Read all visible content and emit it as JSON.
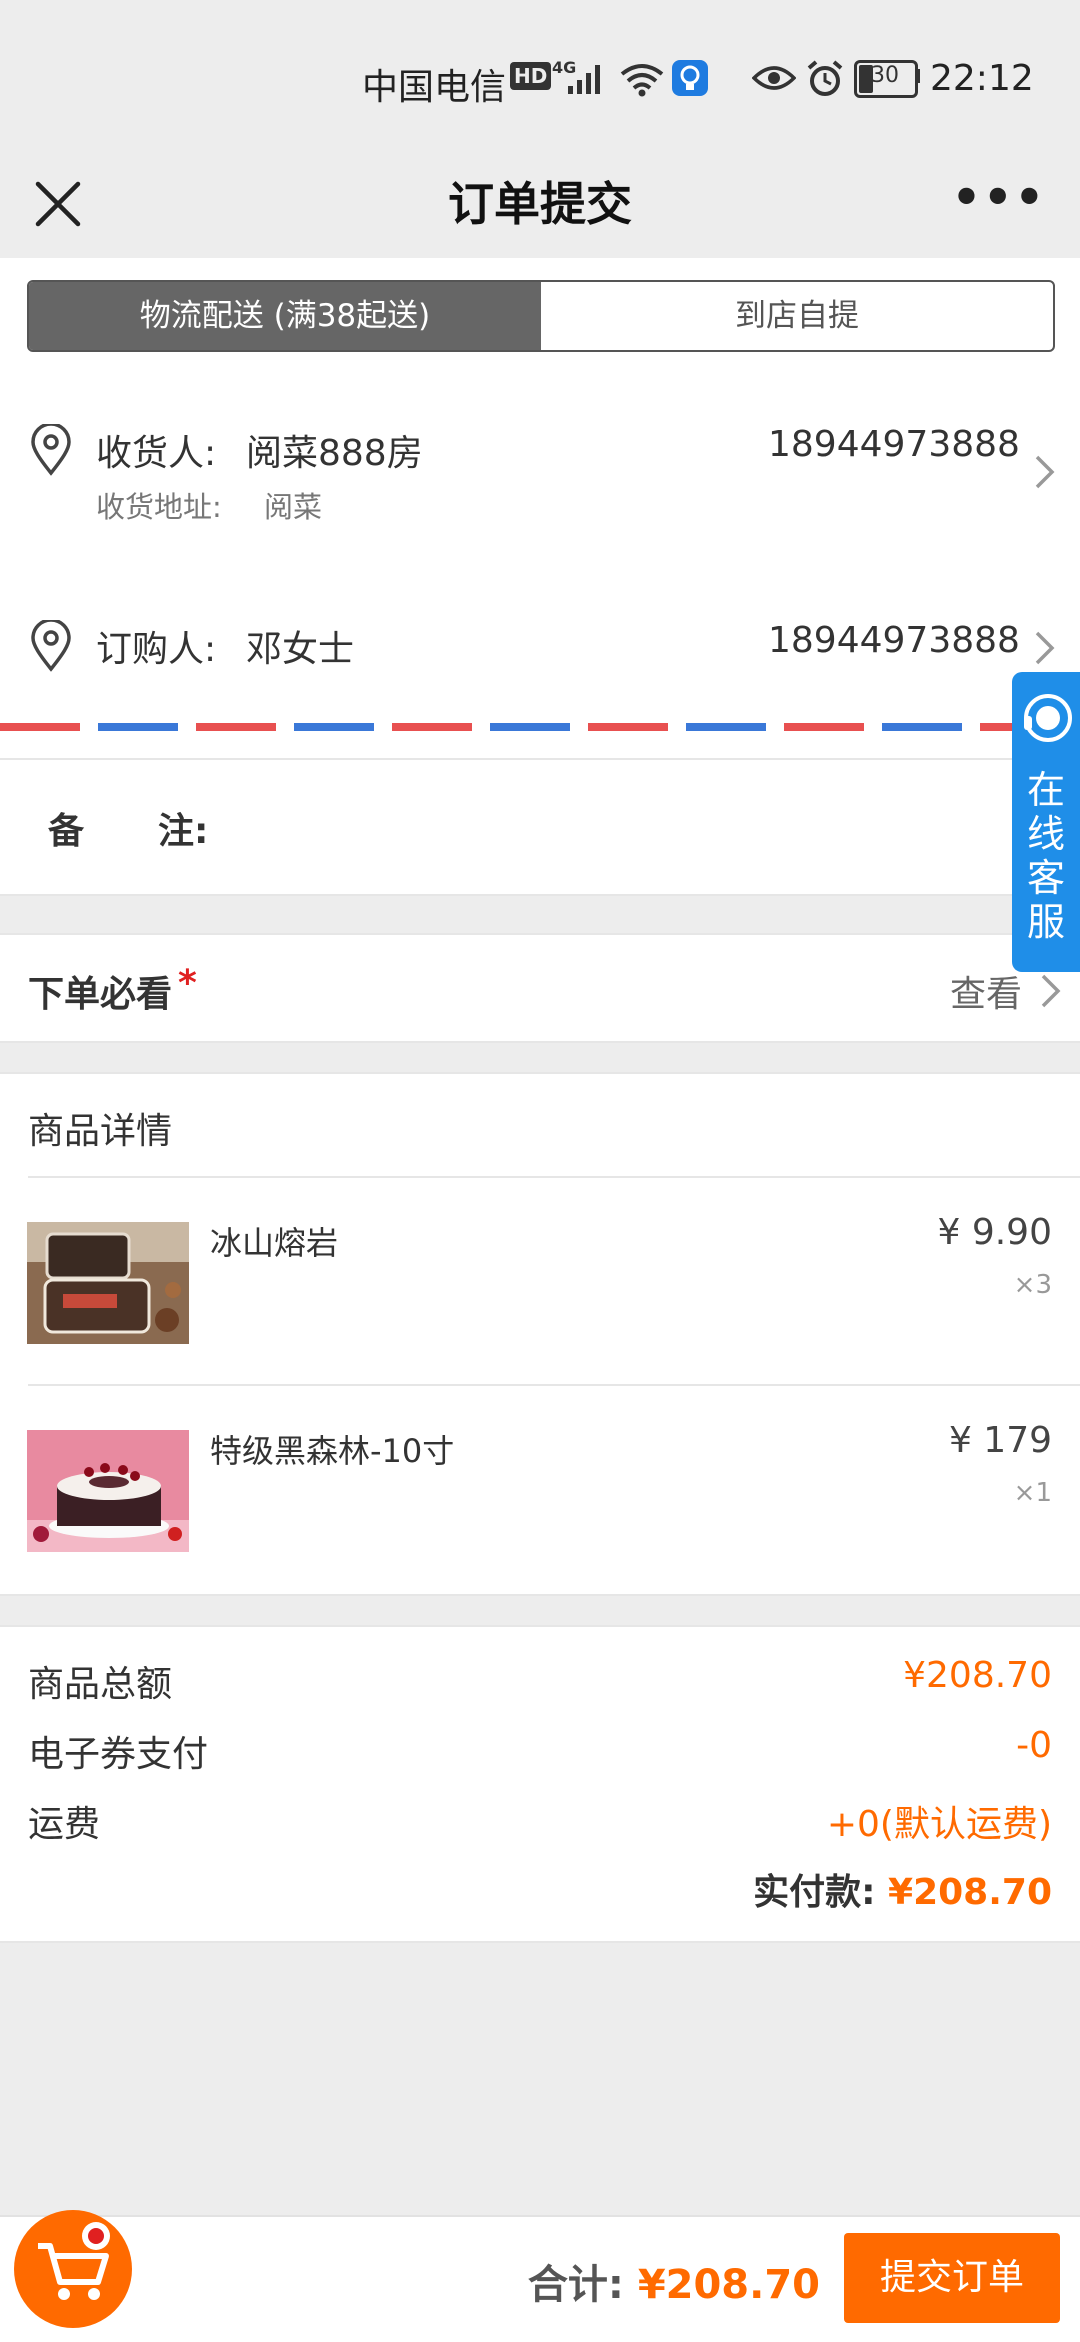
{
  "status_bar": {
    "carrier": "中国电信",
    "hd_badge": "HD",
    "network": "4G",
    "battery": "30",
    "time": "22:12"
  },
  "navbar": {
    "title": "订单提交",
    "more": "•••"
  },
  "delivery_tabs": [
    {
      "label": "物流配送 (满38起送)",
      "active": true
    },
    {
      "label": "到店自提",
      "active": false
    }
  ],
  "receiver": {
    "label": "收货人:",
    "name": "阅菜888房",
    "phone": "18944973888",
    "address_label": "收货地址:",
    "address": "阅菜"
  },
  "buyer": {
    "label": "订购人:",
    "name": "邓女士",
    "phone": "18944973888"
  },
  "remark": {
    "label_a": "备",
    "label_b": "注:"
  },
  "notice": {
    "label": "下单必看",
    "required_mark": "*",
    "action": "查看"
  },
  "products": {
    "title": "商品详情",
    "items": [
      {
        "name": "冰山熔岩",
        "price": "¥ 9.90",
        "qty": "×3"
      },
      {
        "name": "特级黑森林-10寸",
        "price": "¥ 179",
        "qty": "×1"
      }
    ]
  },
  "summary": {
    "rows": [
      {
        "label": "商品总额",
        "value": "¥208.70"
      },
      {
        "label": "电子券支付",
        "value": "-0"
      },
      {
        "label": "运费",
        "value": "+0(默认运费)"
      }
    ],
    "paid_label": "实付款:",
    "paid_value": "¥208.70"
  },
  "service": {
    "label": "在线客服"
  },
  "bottom": {
    "total_label": "合计:",
    "total_value": "¥208.70",
    "submit": "提交订单"
  },
  "colors": {
    "accent": "#ff6a00",
    "service_blue": "#1f8ee8",
    "tab_active": "#666666"
  }
}
